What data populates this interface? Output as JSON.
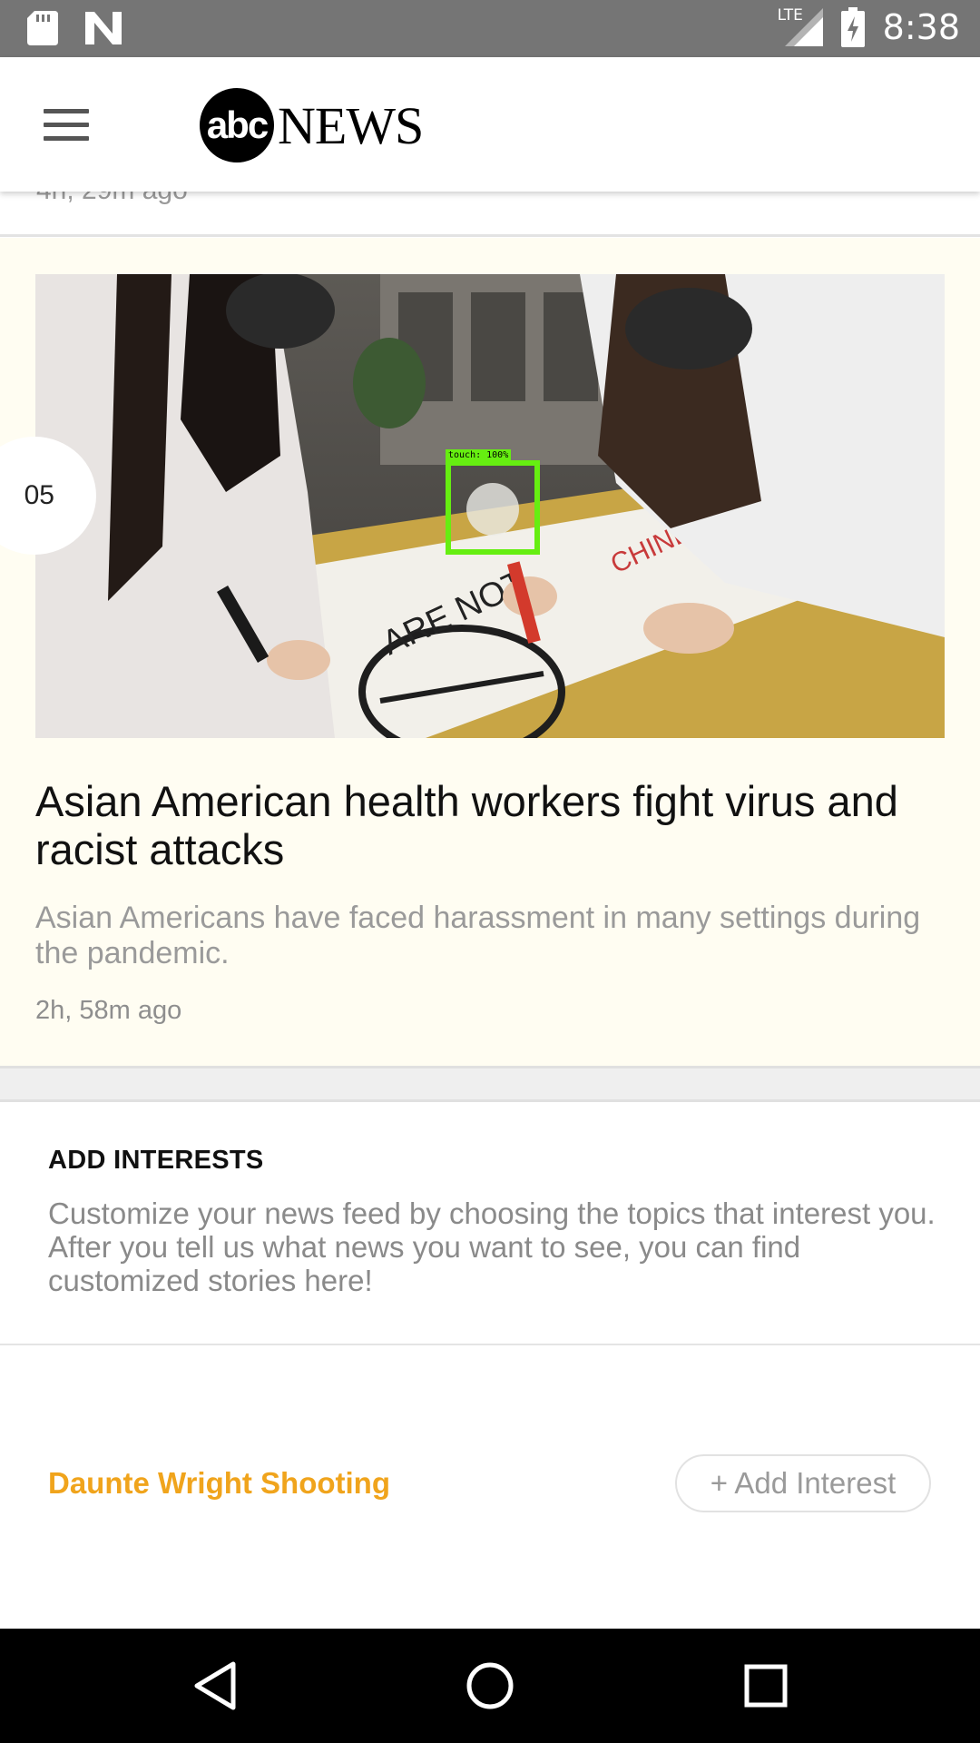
{
  "status_bar": {
    "time": "8:38",
    "network": "LTE",
    "icons": [
      "sd-card-icon",
      "n-notification-icon",
      "signal-icon",
      "battery-charging-icon"
    ]
  },
  "header": {
    "menu_icon": "hamburger-menu-icon",
    "logo_abc": "abc",
    "logo_news": "NEWS"
  },
  "feed": {
    "previous_item_time": "4h, 29m ago",
    "featured": {
      "rank": "05",
      "title": "Asian American health workers fight virus and racist attacks",
      "description": "Asian Americans have faced harassment in many settings during the pandemic.",
      "time": "2h, 58m ago",
      "touch_overlay": "touch: 100%"
    }
  },
  "interests": {
    "heading": "ADD INTERESTS",
    "body": "Customize your news feed by choosing the topics that interest you. After you tell us what news you want to see, you can find customized stories here!",
    "topics": [
      {
        "name": "Daunte Wright Shooting",
        "action": "+ Add Interest"
      }
    ]
  },
  "colors": {
    "topic_accent": "#f0a41c",
    "card_background": "#fffdf2",
    "status_bar": "#757575"
  },
  "nav": {
    "back": "back-triangle-icon",
    "home": "home-circle-icon",
    "recents": "recents-square-icon"
  }
}
